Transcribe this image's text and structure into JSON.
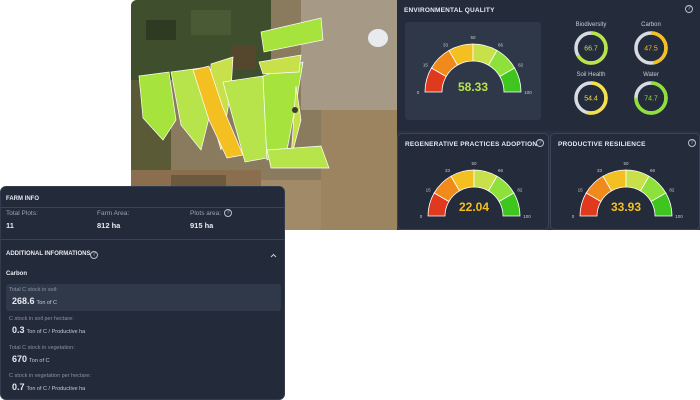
{
  "environmental_quality": {
    "title": "ENVIRONMENTAL QUALITY",
    "value": "58.33",
    "ticks": [
      "0",
      "15",
      "33",
      "50",
      "66",
      "82",
      "100"
    ],
    "indicators": [
      {
        "label": "Biodiversity",
        "value": "66.7",
        "fraction": 0.667,
        "color": "#b7e44a"
      },
      {
        "label": "Carbon",
        "value": "47.5",
        "fraction": 0.475,
        "color": "#f4c021"
      },
      {
        "label": "Soil Health",
        "value": "54.4",
        "fraction": 0.544,
        "color": "#f4e04a"
      },
      {
        "label": "Water",
        "value": "74.7",
        "fraction": 0.747,
        "color": "#8ee03a"
      }
    ]
  },
  "regenerative": {
    "title": "REGENERATIVE PRACTICES ADOPTION",
    "value": "22.04",
    "ticks": [
      "0",
      "15",
      "33",
      "50",
      "66",
      "82",
      "100"
    ]
  },
  "resilience": {
    "title": "PRODUCTIVE RESILIENCE",
    "value": "33.93",
    "ticks": [
      "0",
      "15",
      "33",
      "50",
      "66",
      "82",
      "100"
    ]
  },
  "farm_info": {
    "title": "FARM INFO",
    "total_plots_label": "Total Plots:",
    "total_plots": "11",
    "farm_area_label": "Farm Area:",
    "farm_area": "812 ha",
    "plots_area_label": "Plots area:",
    "plots_area": "915 ha"
  },
  "additional": {
    "title": "ADDITIONAL INFORMATIONS",
    "section": "Carbon",
    "rows": [
      {
        "label": "Total C stock in soil:",
        "value": "268.6",
        "unit": "Ton of C"
      },
      {
        "label": "C stock in soil per hectare:",
        "value": "0.3",
        "unit": "Ton of C / Productive ha"
      },
      {
        "label": "Total C stock in vegetation:",
        "value": "670",
        "unit": "Ton of C"
      },
      {
        "label": "C stock in vegetation per hectare:",
        "value": "0.7",
        "unit": "Ton of C / Productive ha"
      }
    ]
  },
  "colors": {
    "gauge": [
      "#e03a1e",
      "#f08a1a",
      "#f4c021",
      "#c8e04a",
      "#8ee03a",
      "#3ec61e"
    ]
  }
}
